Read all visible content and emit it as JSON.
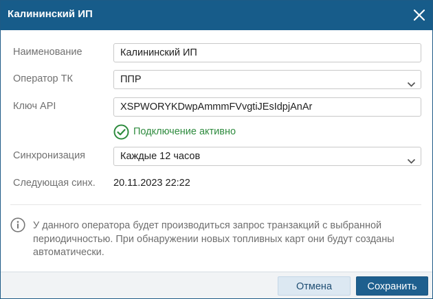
{
  "dialog": {
    "title": "Калининский ИП",
    "close_icon": "close-icon"
  },
  "form": {
    "name": {
      "label": "Наименование",
      "value": "Калининский ИП"
    },
    "operator": {
      "label": "Оператор ТК",
      "value": "ППР"
    },
    "api_key": {
      "label": "Ключ API",
      "value": "XSPWORYKDwpAmmmFVvgtiJEsIdpjAnAr"
    },
    "connection_status": {
      "text": "Подключение активно",
      "icon": "check-circle-icon",
      "color": "#2e8b3e"
    },
    "sync": {
      "label": "Синхронизация",
      "value": "Каждые 12 часов"
    },
    "next_sync": {
      "label": "Следующая синх.",
      "value": "20.11.2023 22:22"
    }
  },
  "info": {
    "icon": "info-icon",
    "text": "У данного оператора будет производиться запрос транзакций с выбранной периодичностью. При обнаружении новых топливных карт они будут созданы автоматически."
  },
  "footer": {
    "cancel_label": "Отмена",
    "save_label": "Сохранить"
  },
  "colors": {
    "titlebar": "#175c8a",
    "primary_button": "#1e5f8e",
    "secondary_button": "#dce8f2",
    "success": "#2e8b3e"
  }
}
